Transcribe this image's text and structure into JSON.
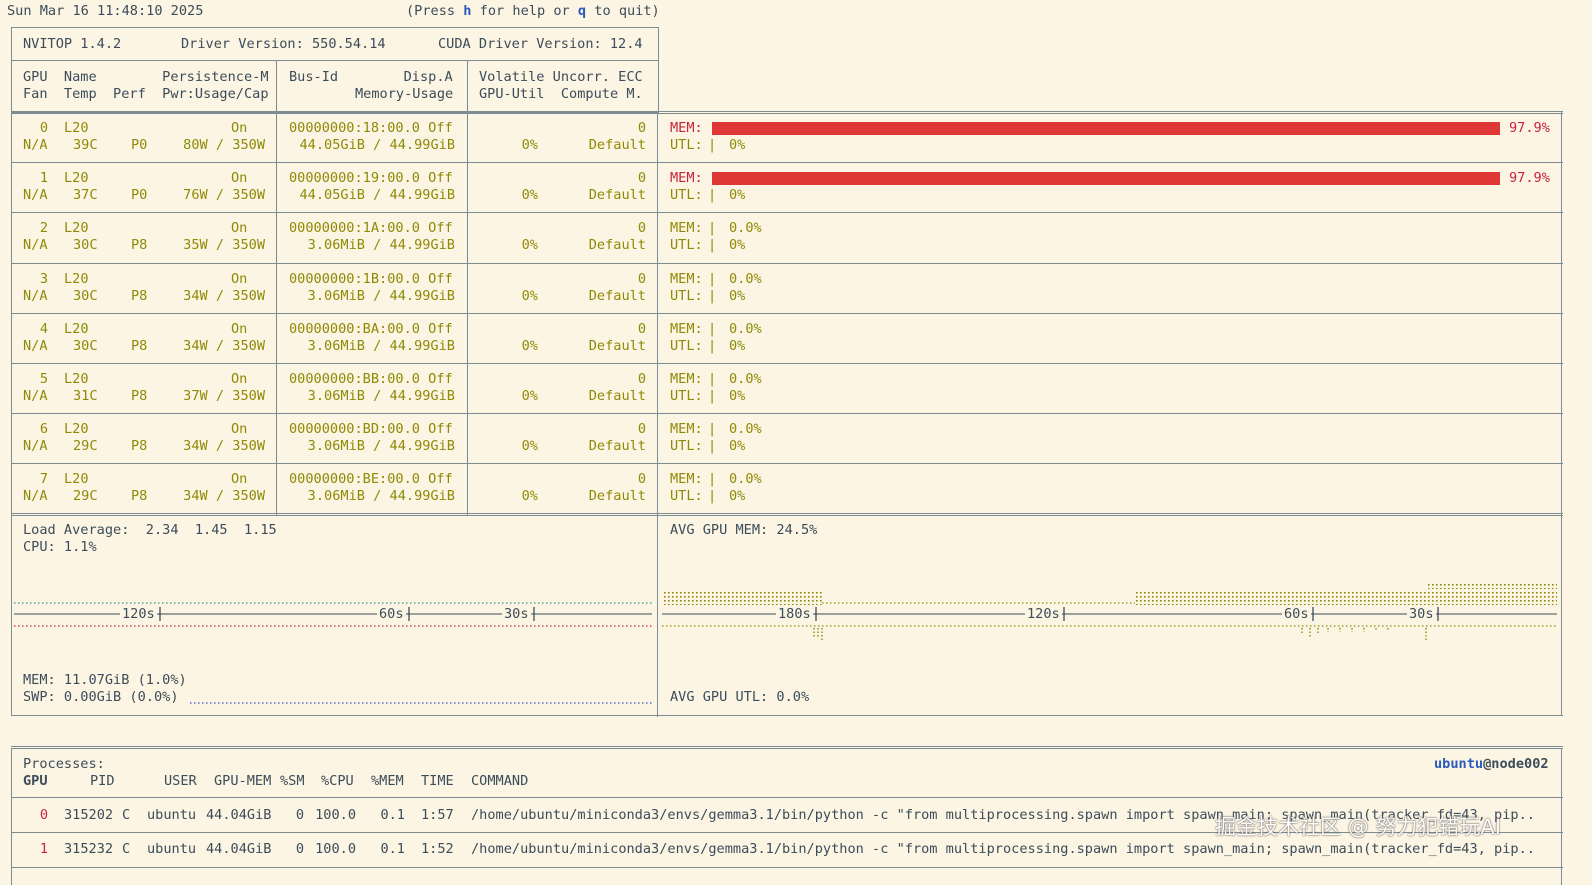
{
  "topline": {
    "datetime": "Sun Mar 16 11:48:10 2025",
    "help_pre": "(Press ",
    "help_key_h": "h",
    "help_mid": " for help or ",
    "help_key_q": "q",
    "help_post": " to quit)"
  },
  "header": {
    "version": "NVITOP 1.4.2",
    "driver": "Driver Version: 550.54.14",
    "cuda": "CUDA Driver Version: 12.4",
    "col1_line1": "GPU  Name        Persistence-M",
    "col1_line2": "Fan  Temp  Perf  Pwr:Usage/Cap",
    "col2_line1": "Bus-Id        Disp.A",
    "col2_line2": "Memory-Usage",
    "col3_line1": "Volatile Uncorr. ECC",
    "col3_line2": "GPU-Util  Compute M."
  },
  "gpus": [
    {
      "id": "0",
      "name": "L20",
      "persist": "On",
      "fan": "N/A",
      "temp": "39C",
      "perf": "P0",
      "pwr": "80W / 350W",
      "bus": "00000000:18:00.0 Off",
      "mem": "44.05GiB / 44.99GiB",
      "ecc": "0",
      "util": "0%",
      "compute": "Default",
      "mem_pct": 97.9,
      "mem_label": "97.9%",
      "util_label": "0%"
    },
    {
      "id": "1",
      "name": "L20",
      "persist": "On",
      "fan": "N/A",
      "temp": "37C",
      "perf": "P0",
      "pwr": "76W / 350W",
      "bus": "00000000:19:00.0 Off",
      "mem": "44.05GiB / 44.99GiB",
      "ecc": "0",
      "util": "0%",
      "compute": "Default",
      "mem_pct": 97.9,
      "mem_label": "97.9%",
      "util_label": "0%"
    },
    {
      "id": "2",
      "name": "L20",
      "persist": "On",
      "fan": "N/A",
      "temp": "30C",
      "perf": "P8",
      "pwr": "35W / 350W",
      "bus": "00000000:1A:00.0 Off",
      "mem": "3.06MiB / 44.99GiB",
      "ecc": "0",
      "util": "0%",
      "compute": "Default",
      "mem_pct": 0.0,
      "mem_label": "0.0%",
      "util_label": "0%"
    },
    {
      "id": "3",
      "name": "L20",
      "persist": "On",
      "fan": "N/A",
      "temp": "30C",
      "perf": "P8",
      "pwr": "34W / 350W",
      "bus": "00000000:1B:00.0 Off",
      "mem": "3.06MiB / 44.99GiB",
      "ecc": "0",
      "util": "0%",
      "compute": "Default",
      "mem_pct": 0.0,
      "mem_label": "0.0%",
      "util_label": "0%"
    },
    {
      "id": "4",
      "name": "L20",
      "persist": "On",
      "fan": "N/A",
      "temp": "30C",
      "perf": "P8",
      "pwr": "34W / 350W",
      "bus": "00000000:BA:00.0 Off",
      "mem": "3.06MiB / 44.99GiB",
      "ecc": "0",
      "util": "0%",
      "compute": "Default",
      "mem_pct": 0.0,
      "mem_label": "0.0%",
      "util_label": "0%"
    },
    {
      "id": "5",
      "name": "L20",
      "persist": "On",
      "fan": "N/A",
      "temp": "31C",
      "perf": "P8",
      "pwr": "37W / 350W",
      "bus": "00000000:BB:00.0 Off",
      "mem": "3.06MiB / 44.99GiB",
      "ecc": "0",
      "util": "0%",
      "compute": "Default",
      "mem_pct": 0.0,
      "mem_label": "0.0%",
      "util_label": "0%"
    },
    {
      "id": "6",
      "name": "L20",
      "persist": "On",
      "fan": "N/A",
      "temp": "29C",
      "perf": "P8",
      "pwr": "34W / 350W",
      "bus": "00000000:BD:00.0 Off",
      "mem": "3.06MiB / 44.99GiB",
      "ecc": "0",
      "util": "0%",
      "compute": "Default",
      "mem_pct": 0.0,
      "mem_label": "0.0%",
      "util_label": "0%"
    },
    {
      "id": "7",
      "name": "L20",
      "persist": "On",
      "fan": "N/A",
      "temp": "29C",
      "perf": "P8",
      "pwr": "34W / 350W",
      "bus": "00000000:BE:00.0 Off",
      "mem": "3.06MiB / 44.99GiB",
      "ecc": "0",
      "util": "0%",
      "compute": "Default",
      "mem_pct": 0.0,
      "mem_label": "0.0%",
      "util_label": "0%"
    }
  ],
  "labels": {
    "mem": "MEM:",
    "utl": "UTL:",
    "pipe": "|"
  },
  "host": {
    "load": "Load Average:  2.34  1.45  1.15",
    "cpu": "CPU: 1.1%",
    "mem": "MEM: 11.07GiB (1.0%)",
    "swp": "SWP: 0.00GiB (0.0%)",
    "avg_gpu_mem": "AVG GPU MEM: 24.5%",
    "avg_gpu_utl": "AVG GPU UTL: 0.0%",
    "left_ticks": [
      "120s",
      "60s",
      "30s"
    ],
    "right_ticks": [
      "180s",
      "120s",
      "60s",
      "30s"
    ]
  },
  "processes": {
    "title": "Processes:",
    "user": "ubuntu",
    "at_host": "@node002",
    "headers": {
      "gpu": "GPU",
      "pid": "PID",
      "user": "USER",
      "gpu_mem": "GPU-MEM",
      "sm": "%SM",
      "cpu": "%CPU",
      "mem": "%MEM",
      "time": "TIME",
      "command": "COMMAND"
    },
    "rows": [
      {
        "gpu": "0",
        "pid": "315202",
        "type": "C",
        "user": "ubuntu",
        "gpu_mem": "44.04GiB",
        "sm": "0",
        "cpu": "100.0",
        "mem": "0.1",
        "time": "1:57",
        "command": "/home/ubuntu/miniconda3/envs/gemma3.1/bin/python -c \"from multiprocessing.spawn import spawn_main; spawn_main(tracker_fd=43, pip.."
      },
      {
        "gpu": "1",
        "pid": "315232",
        "type": "C",
        "user": "ubuntu",
        "gpu_mem": "44.04GiB",
        "sm": "0",
        "cpu": "100.0",
        "mem": "0.1",
        "time": "1:52",
        "command": "/home/ubuntu/miniconda3/envs/gemma3.1/bin/python -c \"from multiprocessing.spawn import spawn_main; spawn_main(tracker_fd=43, pip.."
      }
    ]
  },
  "watermark": "掘金技术社区 @ 努力犯错玩AI",
  "colors": {
    "bg": "#fdf5e3",
    "text": "#3b4c5a",
    "yellow": "#8e8a07",
    "red": "#c7233a",
    "bar": "#df3636",
    "blue": "#2a5abf",
    "border": "#7b8c93"
  }
}
